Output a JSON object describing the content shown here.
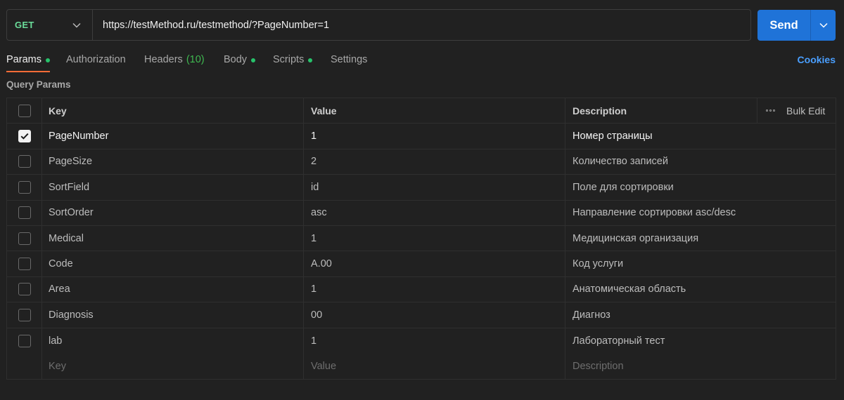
{
  "request": {
    "method": "GET",
    "url": "https://testMethod.ru/testmethod/?PageNumber=1",
    "send_label": "Send"
  },
  "tabs": [
    {
      "label": "Params",
      "dot": true,
      "active": true
    },
    {
      "label": "Authorization"
    },
    {
      "label": "Headers",
      "count": "(10)"
    },
    {
      "label": "Body",
      "dot": true
    },
    {
      "label": "Scripts",
      "dot": true
    },
    {
      "label": "Settings"
    }
  ],
  "cookies_label": "Cookies",
  "section_title": "Query Params",
  "table": {
    "headers": {
      "key": "Key",
      "value": "Value",
      "description": "Description",
      "bulk_edit": "Bulk Edit"
    },
    "rows": [
      {
        "key": "PageNumber",
        "value": "1",
        "description": "Номер страницы",
        "checked": true
      },
      {
        "key": "PageSize",
        "value": "2",
        "description": "Количество записей",
        "checked": false
      },
      {
        "key": "SortField",
        "value": "id",
        "description": "Поле для сортировки",
        "checked": false
      },
      {
        "key": "SortOrder",
        "value": "asc",
        "description": "Направление сортировки asc/desc",
        "checked": false
      },
      {
        "key": "Medical",
        "value": "1",
        "description": "Медицинская организация",
        "checked": false
      },
      {
        "key": "Code",
        "value": "A.00",
        "description": "Код услуги",
        "checked": false
      },
      {
        "key": "Area",
        "value": "1",
        "description": "Анатомическая область",
        "checked": false
      },
      {
        "key": "Diagnosis",
        "value": "00",
        "description": "Диагноз",
        "checked": false
      },
      {
        "key": "lab",
        "value": "1",
        "description": "Лабораторный тест",
        "checked": false
      }
    ],
    "placeholder": {
      "key": "Key",
      "value": "Value",
      "description": "Description"
    }
  },
  "colors": {
    "method": "#6bdd9a",
    "send": "#1f73d8",
    "active_tab_underline": "#ff6c37",
    "dot": "#27c26b",
    "cookies": "#4a9fff"
  }
}
